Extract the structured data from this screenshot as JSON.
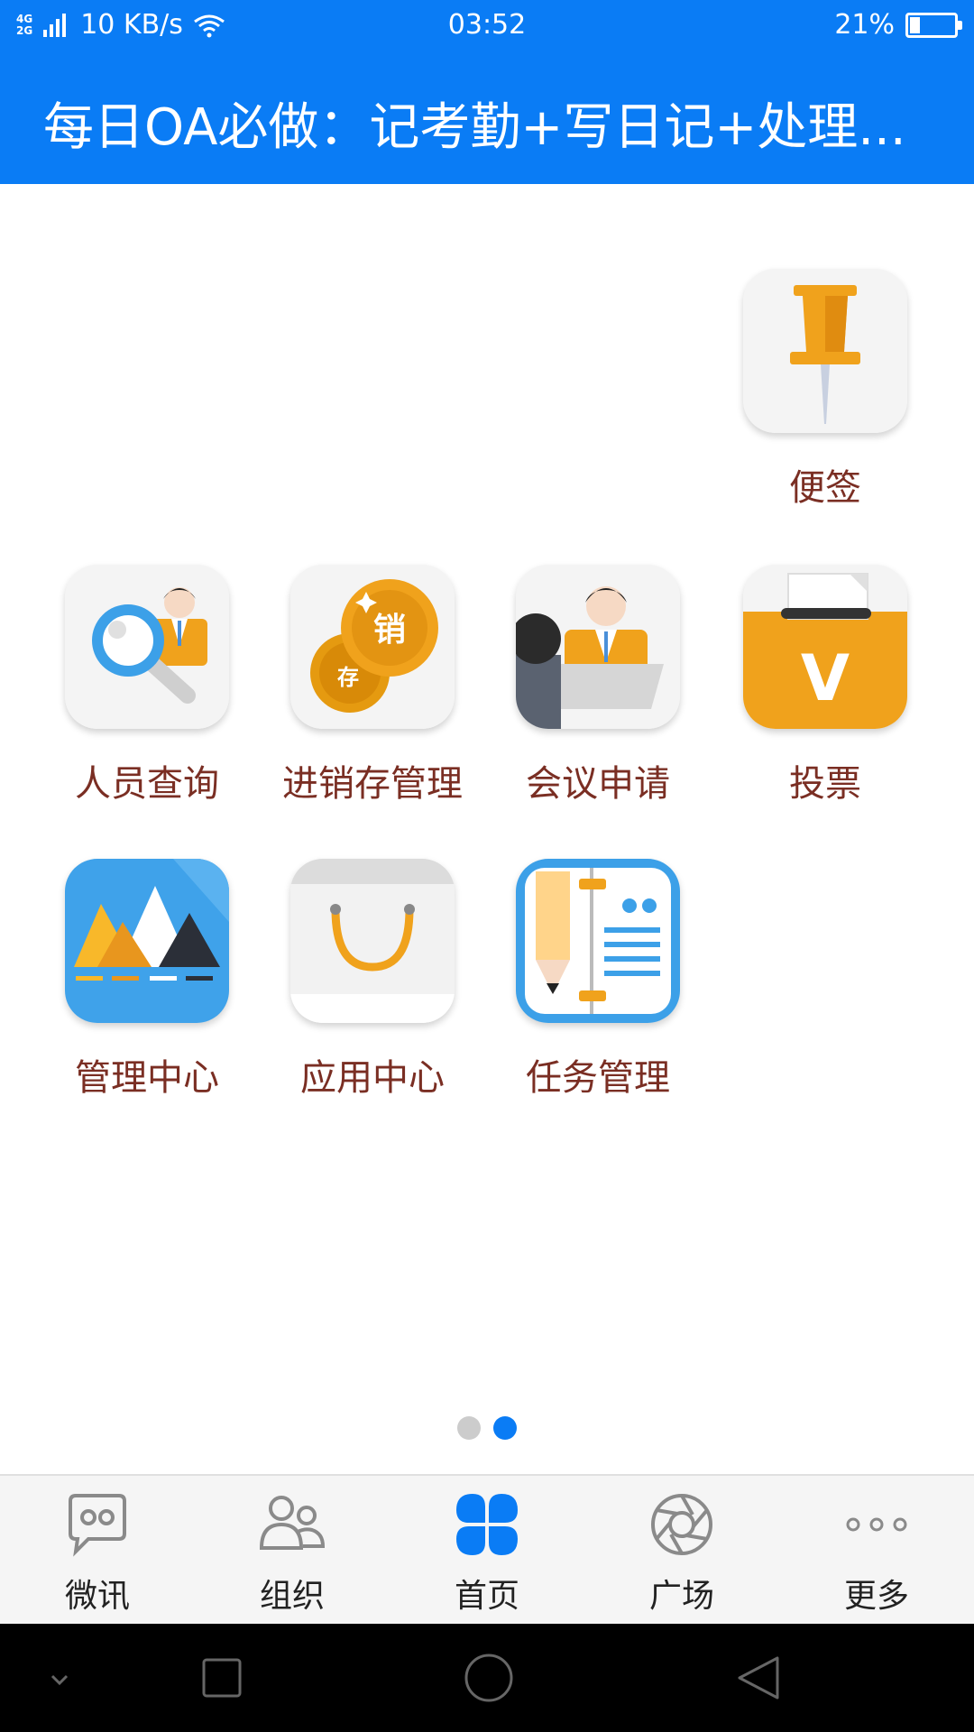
{
  "status_bar": {
    "network_top": "4G",
    "network_bottom": "2G",
    "speed": "10 KB/s",
    "time": "03:52",
    "battery_percent_text": "21%",
    "battery_level": 0.21
  },
  "header": {
    "title": "每日OA必做：记考勤+写日记+处理..."
  },
  "apps": [
    {
      "label": "便签",
      "icon": "pushpin-icon"
    },
    {
      "label": "人员查询",
      "icon": "person-search-icon"
    },
    {
      "label": "进销存管理",
      "icon": "coins-icon"
    },
    {
      "label": "会议申请",
      "icon": "meeting-icon"
    },
    {
      "label": "投票",
      "icon": "ballot-box-icon"
    },
    {
      "label": "管理中心",
      "icon": "mountains-icon"
    },
    {
      "label": "应用中心",
      "icon": "shopping-bag-icon"
    },
    {
      "label": "任务管理",
      "icon": "notebook-icon"
    }
  ],
  "coin_labels": {
    "top": "销",
    "bottom": "存"
  },
  "ballot_letter": "V",
  "pager": {
    "count": 2,
    "active_index": 1
  },
  "tabs": [
    {
      "label": "微讯",
      "icon": "chat-bubble-icon",
      "active": false
    },
    {
      "label": "组织",
      "icon": "people-icon",
      "active": false
    },
    {
      "label": "首页",
      "icon": "four-leaf-grid-icon",
      "active": true
    },
    {
      "label": "广场",
      "icon": "aperture-icon",
      "active": false
    },
    {
      "label": "更多",
      "icon": "more-dots-icon",
      "active": false
    }
  ],
  "colors": {
    "primary": "#0a7cf5",
    "label": "#7a2e23",
    "dot_inactive": "#cccccc",
    "tab_inactive_icon": "#8a8a8a"
  }
}
